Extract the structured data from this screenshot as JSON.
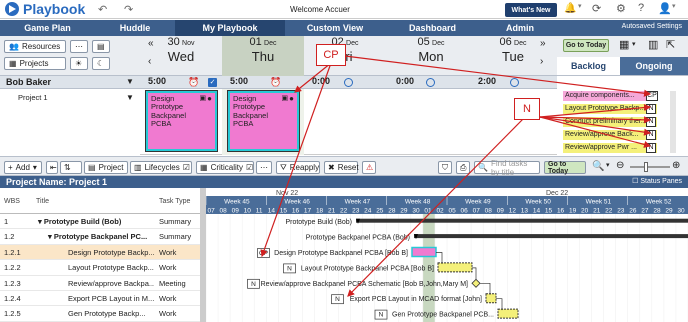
{
  "app": {
    "name": "Playbook",
    "welcome": "Welcome Accuer",
    "whats_new": "What's New"
  },
  "nav": {
    "tabs": [
      "Game Plan",
      "Huddle",
      "My Playbook",
      "Custom View",
      "Dashboard",
      "Admin"
    ],
    "autosaved": "Autosaved Settings"
  },
  "planner": {
    "resources": "Resources",
    "projects": "Projects",
    "days": [
      {
        "num": "30",
        "mon": "Nov",
        "name": "Wed"
      },
      {
        "num": "01",
        "mon": "Dec",
        "name": "Thu"
      },
      {
        "num": "02",
        "mon": "Dec",
        "name": "Fri"
      },
      {
        "num": "05",
        "mon": "Dec",
        "name": "Mon"
      },
      {
        "num": "06",
        "mon": "Dec",
        "name": "Tue"
      }
    ],
    "go_to_today": "Go to Today",
    "backlog": "Backlog",
    "ongoing": "Ongoing"
  },
  "person": {
    "name": "Bob Baker",
    "project": "Project 1",
    "times": [
      "5:00",
      "5:00",
      "0:00",
      "0:00",
      "2:00"
    ]
  },
  "cards": [
    {
      "text": "Design Prototype Backpanel PCBA"
    },
    {
      "text": "Design Prototype Backpanel PCBA"
    }
  ],
  "backlog_items": [
    {
      "text": "Acquire components...",
      "badge": "CP",
      "color": "#f5a8d8"
    },
    {
      "text": "Layout Prototype Backp...",
      "badge": "N",
      "color": "#f4f07a"
    },
    {
      "text": "Conduct preliminary ther...",
      "badge": "N",
      "color": "#f4f07a"
    },
    {
      "text": "Review/approve Back...",
      "badge": "N",
      "color": "#f4f07a"
    },
    {
      "text": "Review/approve Pwr ...",
      "badge": "N",
      "color": "#f4f07a"
    }
  ],
  "callouts": {
    "cp": "CP",
    "n": "N"
  },
  "gantt_toolbar": {
    "add": "Add",
    "project": "Project",
    "lifecycles": "Lifecycles",
    "criticality": "Criticality",
    "reapply": "Reapply",
    "reset": "Reset",
    "find_placeholder": "Find tasks by title",
    "go_to_today": "Go to Today",
    "status_panes": "Status Panes"
  },
  "project_name": "Project Name: Project 1",
  "grid": {
    "columns": [
      "WBS",
      "Title",
      "Task Type"
    ],
    "rows": [
      {
        "wbs": "1",
        "title": "Prototype Build (Bob)",
        "type": "Summary"
      },
      {
        "wbs": "1.2",
        "title": "Prototype Backpanel PC...",
        "type": "Summary"
      },
      {
        "wbs": "1.2.1",
        "title": "Design Prototype Backp...",
        "type": "Work"
      },
      {
        "wbs": "1.2.2",
        "title": "Layout Prototype Backp...",
        "type": "Work"
      },
      {
        "wbs": "1.2.3",
        "title": "Review/approve Backpa...",
        "type": "Meeting"
      },
      {
        "wbs": "1.2.4",
        "title": "Export PCB Layout in M...",
        "type": "Work"
      },
      {
        "wbs": "1.2.5",
        "title": "Gen Prototype Backp...",
        "type": "Work"
      }
    ]
  },
  "timeline": {
    "months": [
      "Nov 22",
      "Dec 22"
    ],
    "weeks": [
      "Week 45",
      "Week 46",
      "Week 47",
      "Week 48",
      "Week 49",
      "Week 50",
      "Week 51",
      "Week 52"
    ],
    "days": [
      "07",
      "08",
      "09",
      "10",
      "11",
      "14",
      "15",
      "16",
      "17",
      "18",
      "21",
      "22",
      "23",
      "24",
      "25",
      "28",
      "29",
      "30",
      "01",
      "02",
      "05",
      "06",
      "07",
      "08",
      "09",
      "12",
      "13",
      "14",
      "15",
      "16",
      "19",
      "20",
      "21",
      "22",
      "23",
      "26",
      "27",
      "28",
      "29",
      "30"
    ]
  },
  "bars": [
    {
      "label": "Prototype Build (Bob)"
    },
    {
      "label": "Prototype Backpanel PCBA (Bob)"
    },
    {
      "label": "Design Prototype Backpanel PCBA [Bob B]",
      "badge": "CP"
    },
    {
      "label": "Layout Prototype Backpanel PCBA [Bob B]",
      "badge": "N"
    },
    {
      "label": "Review/approve Backpanel PCBA Schematic [Bob B,John,Mary M]",
      "badge": "N"
    },
    {
      "label": "Export PCB Layout in MCAD format [John]",
      "badge": "N"
    },
    {
      "label": "Gen Prototype Backpanel PCB...",
      "badge": "N"
    }
  ]
}
